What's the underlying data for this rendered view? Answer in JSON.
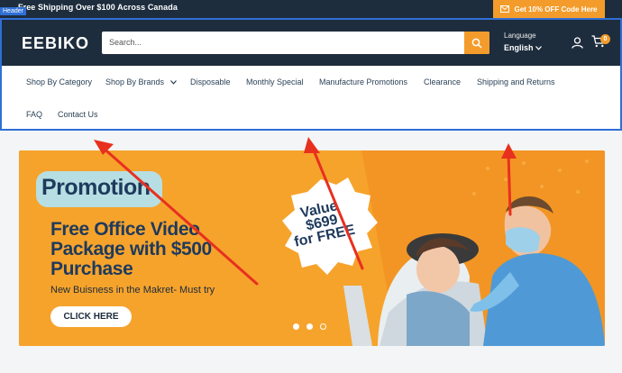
{
  "topbar": {
    "shipping_text": "Free Shipping Over $100 Across Canada",
    "header_tag": "Header",
    "promo_label": "Get 10% OFF Code Here"
  },
  "header": {
    "logo": "EEBIKO",
    "search_placeholder": "Search...",
    "language_label": "Language",
    "language_value": "English",
    "cart_count": "0"
  },
  "nav": {
    "items": [
      "Shop By Category",
      "Shop By Brands",
      "Disposable",
      "Monthly Special",
      "Manufacture Promotions",
      "Clearance",
      "Shipping and Returns",
      "FAQ",
      "Contact Us"
    ]
  },
  "banner": {
    "promotion": "Promotion",
    "headline": "Free Office Video Package with $500 Purchase",
    "subline": "New Buisness in the Makret- Must try",
    "cta": "CLICK HERE",
    "value_line1": "Value",
    "value_line2": "$699",
    "value_line3": "for FREE"
  },
  "colors": {
    "header_bg": "#1e2d3d",
    "accent": "#f39c2b",
    "highlight": "#2f6fd6",
    "arrow": "#e8301f"
  }
}
